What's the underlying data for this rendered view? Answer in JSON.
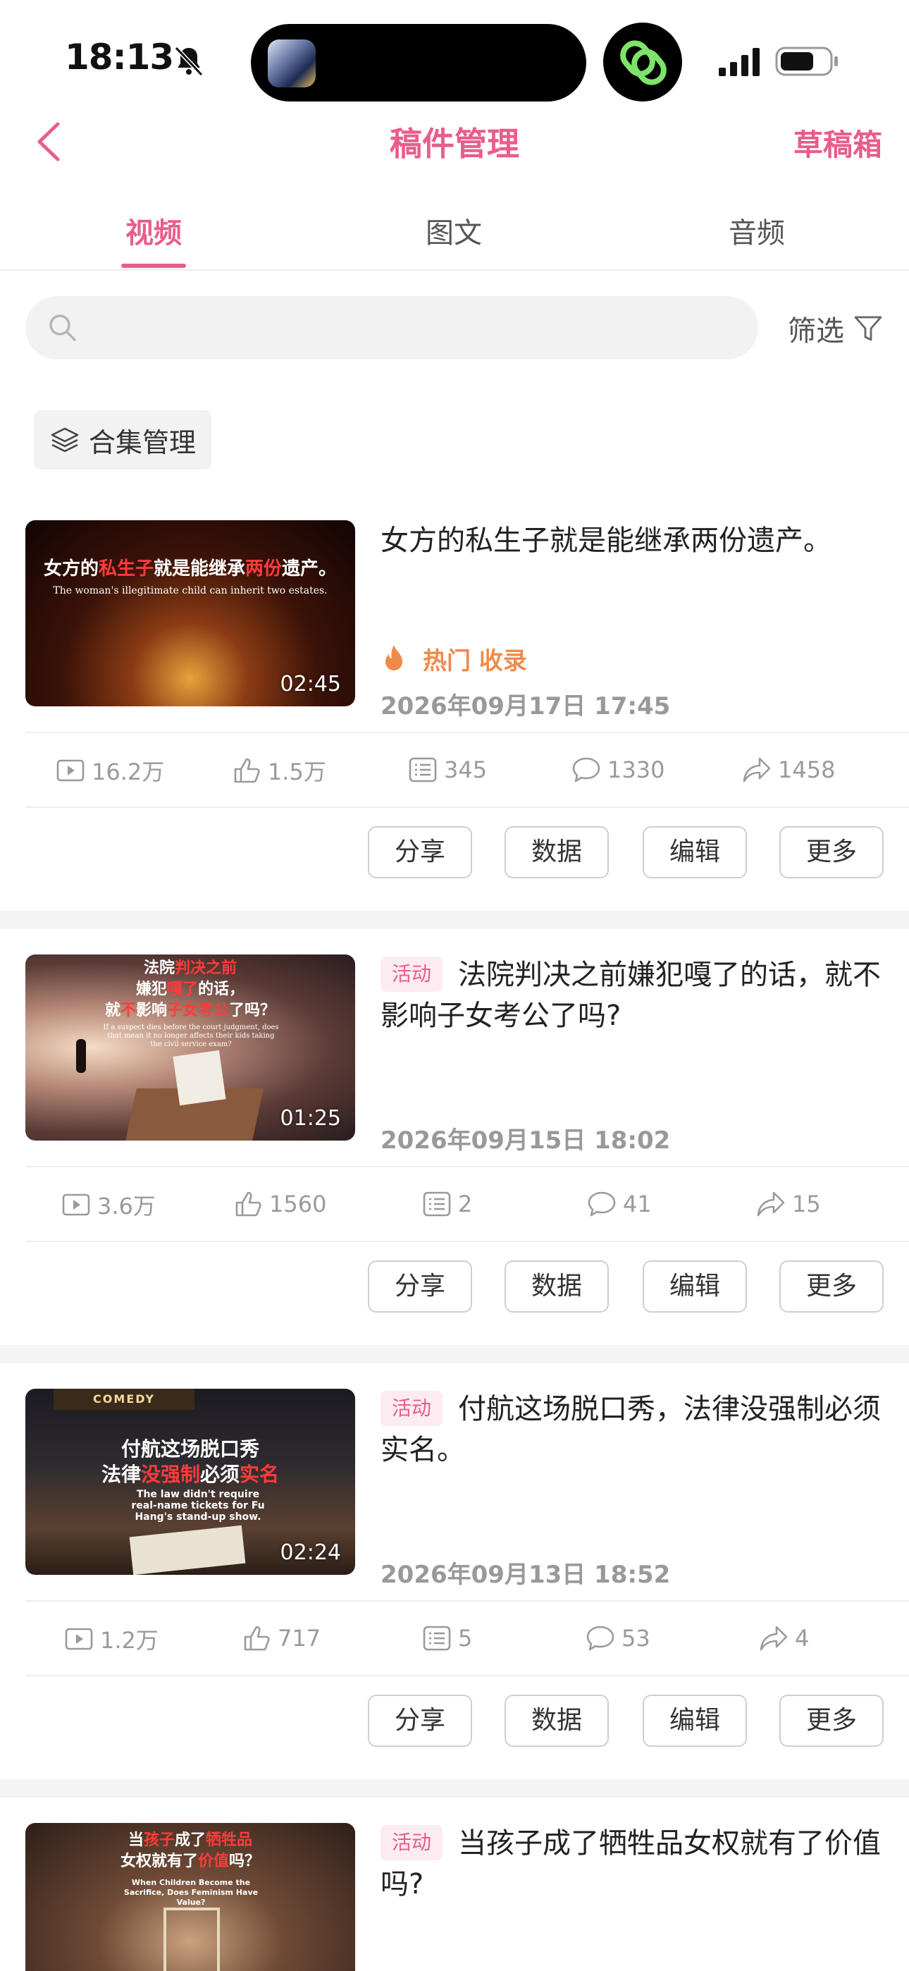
{
  "status_bar": {
    "time": "18:13"
  },
  "nav": {
    "title": "稿件管理",
    "drafts": "草稿箱"
  },
  "tabs": [
    {
      "label": "视频",
      "active": true
    },
    {
      "label": "图文",
      "active": false
    },
    {
      "label": "音频",
      "active": false
    }
  ],
  "search": {
    "placeholder": ""
  },
  "filter": {
    "label": "筛选"
  },
  "collection": {
    "label": "合集管理"
  },
  "colors": {
    "accent": "#e85d8c",
    "hot": "#f08a4b",
    "muted": "#9a9a9a"
  },
  "videos": [
    {
      "title": "女方的私生子就是能继承两份遗产。",
      "tag": "",
      "hot": "热门 收录",
      "date": "2026年09月17日 17:45",
      "duration": "02:45",
      "thumb_cn": [
        "女方的",
        "私生子",
        "就是能继承",
        "两份",
        "遗产。"
      ],
      "thumb_en": "The woman's illegitimate child can inherit two estates.",
      "stats": {
        "plays": "16.2万",
        "likes": "1.5万",
        "danmaku": "345",
        "comments": "1330",
        "shares": "1458"
      }
    },
    {
      "title": "法院判决之前嫌犯嘎了的话，就不影响子女考公了吗?",
      "tag": "活动",
      "hot": "",
      "date": "2026年09月15日 18:02",
      "duration": "01:25",
      "thumb_cn": [
        "法院",
        "判决之前",
        "嫌犯",
        "嘎了",
        "的话，",
        "就",
        "不",
        "影响",
        "子女考公",
        "了吗？"
      ],
      "thumb_en": "If a suspect dies before the court judgment, does that mean it no longer affects their kids taking the civil service exam?",
      "stats": {
        "plays": "3.6万",
        "likes": "1560",
        "danmaku": "2",
        "comments": "41",
        "shares": "15"
      }
    },
    {
      "title": "付航这场脱口秀，法律没强制必须实名。",
      "tag": "活动",
      "hot": "",
      "date": "2026年09月13日 18:52",
      "duration": "02:24",
      "thumb_cn": [
        "付航这场脱口秀",
        "法律",
        "没强制",
        "必须",
        "实名"
      ],
      "thumb_en": "The law didn't require real-name tickets for Fu Hang's stand-up show.",
      "thumb_marquee": "COMEDY",
      "stats": {
        "plays": "1.2万",
        "likes": "717",
        "danmaku": "5",
        "comments": "53",
        "shares": "4"
      }
    },
    {
      "title": "当孩子成了牺牲品女权就有了价值吗?",
      "tag": "活动",
      "hot": "",
      "date": "",
      "duration": "",
      "thumb_cn": [
        "当",
        "孩子",
        "成了",
        "牺牲品",
        "女权就有了",
        "价值",
        "吗？"
      ],
      "thumb_en": "When Children Become the Sacrifice, Does Feminism Have Value?",
      "stats": {}
    }
  ],
  "actions": {
    "share": "分享",
    "data": "数据",
    "edit": "编辑",
    "more": "更多"
  }
}
